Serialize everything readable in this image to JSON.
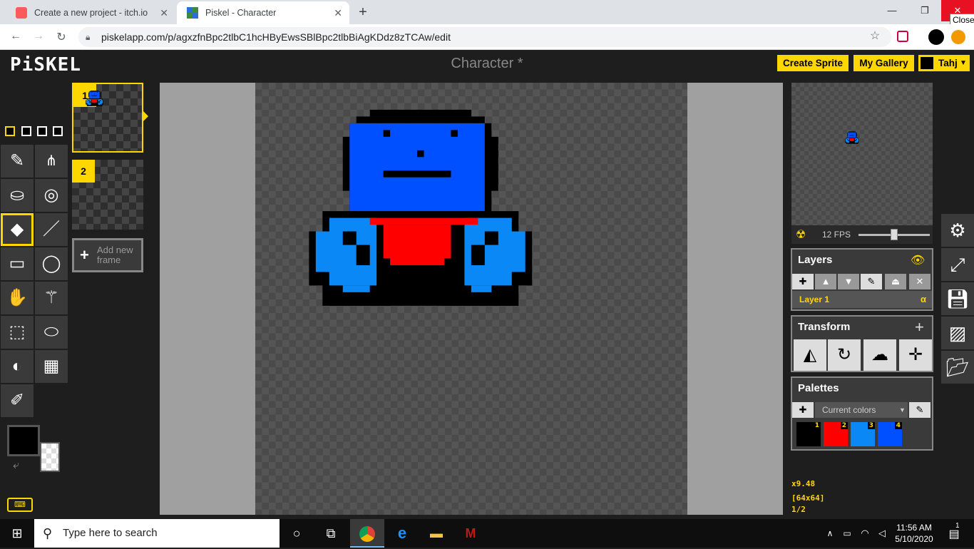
{
  "browser": {
    "tabs": [
      {
        "title": "Create a new project - itch.io",
        "icon": "itchio-icon",
        "icon_color": "#fa5c5c"
      },
      {
        "title": "Piskel - Character",
        "icon": "piskel-icon",
        "active": true
      }
    ],
    "close_tooltip": "Close",
    "url": "piskelapp.com/p/agxzfnBpc2tlbC1hcHByEwsSBlBpc2tlbBiAgKDdz8zTCAw/edit"
  },
  "app": {
    "logo": "PiSKEL",
    "title": "Character *",
    "create_sprite": "Create Sprite",
    "my_gallery": "My Gallery",
    "user": "Tahj",
    "accent_color": "#ffd700"
  },
  "frames": {
    "items": [
      {
        "number": "1"
      },
      {
        "number": "2"
      }
    ],
    "add_frame_label": "Add new frame"
  },
  "preview": {
    "fps_label": "12 FPS",
    "fps": 12
  },
  "layers": {
    "title": "Layers",
    "items": [
      {
        "name": "Layer 1",
        "alpha": "α"
      }
    ]
  },
  "transform": {
    "title": "Transform"
  },
  "palettes": {
    "title": "Palettes",
    "selected": "Current colors",
    "colors": [
      {
        "index": "1",
        "hex": "#000000"
      },
      {
        "index": "2",
        "hex": "#ff0000"
      },
      {
        "index": "3",
        "hex": "#0a88f5"
      },
      {
        "index": "4",
        "hex": "#0050ff"
      }
    ]
  },
  "status": {
    "zoom": "x9.48",
    "size": "[64x64]",
    "frame": "1/2"
  },
  "colors": {
    "primary": "#000000",
    "secondary": "transparent"
  },
  "taskbar": {
    "search_placeholder": "Type here to search",
    "time": "11:56 AM",
    "date": "5/10/2020",
    "notification_count": "1"
  }
}
